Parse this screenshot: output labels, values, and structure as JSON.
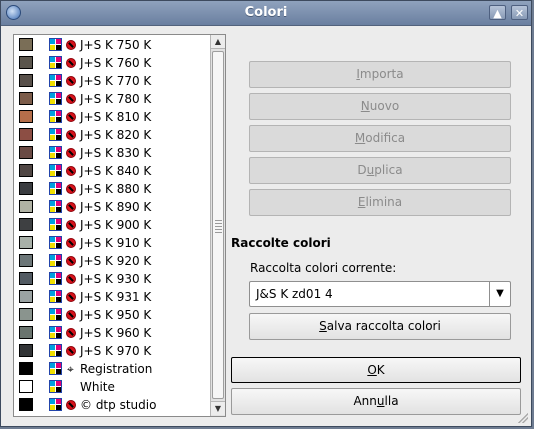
{
  "window": {
    "title": "Colori",
    "buttons": {
      "maximize_glyph": "▲",
      "close_glyph": "✕"
    }
  },
  "colors": [
    {
      "name": "J+S K 750 K",
      "swatch": "#7a6e57",
      "kind": "spot"
    },
    {
      "name": "J+S K 760 K",
      "swatch": "#5a554c",
      "kind": "spot"
    },
    {
      "name": "J+S K 770 K",
      "swatch": "#58504a",
      "kind": "spot"
    },
    {
      "name": "J+S K 780 K",
      "swatch": "#7c5c4a",
      "kind": "spot"
    },
    {
      "name": "J+S K 810 K",
      "swatch": "#b56e4a",
      "kind": "spot"
    },
    {
      "name": "J+S K 820 K",
      "swatch": "#8c4e44",
      "kind": "spot"
    },
    {
      "name": "J+S K 830 K",
      "swatch": "#6a4a44",
      "kind": "spot"
    },
    {
      "name": "J+S K 840 K",
      "swatch": "#504644",
      "kind": "spot"
    },
    {
      "name": "J+S K 880 K",
      "swatch": "#3a3c40",
      "kind": "spot"
    },
    {
      "name": "J+S K 890 K",
      "swatch": "#b0b2a4",
      "kind": "spot"
    },
    {
      "name": "J+S K 900 K",
      "swatch": "#3e4042",
      "kind": "spot"
    },
    {
      "name": "J+S K 910 K",
      "swatch": "#a8b0a8",
      "kind": "spot"
    },
    {
      "name": "J+S K 920 K",
      "swatch": "#6c7678",
      "kind": "spot"
    },
    {
      "name": "J+S K 930 K",
      "swatch": "#525a62",
      "kind": "spot"
    },
    {
      "name": "J+S K 931 K",
      "swatch": "#9aa2a2",
      "kind": "spot"
    },
    {
      "name": "J+S K 950 K",
      "swatch": "#8a948e",
      "kind": "spot"
    },
    {
      "name": "J+S K 960 K",
      "swatch": "#6a746e",
      "kind": "spot"
    },
    {
      "name": "J+S K 970 K",
      "swatch": "#323436",
      "kind": "spot"
    },
    {
      "name": "Registration",
      "swatch": "#000000",
      "kind": "registration"
    },
    {
      "name": "White",
      "swatch": "#ffffff",
      "kind": "process"
    },
    {
      "name": "© dtp studio",
      "swatch": "#000000",
      "kind": "spot"
    }
  ],
  "actions": {
    "import": {
      "label": "Importa",
      "mnemonic_index": 0
    },
    "new": {
      "label": "Nuovo",
      "mnemonic_index": 0
    },
    "edit": {
      "label": "Modifica",
      "mnemonic_index": 0
    },
    "duplicate": {
      "label": "Duplica",
      "mnemonic_index": 1
    },
    "delete": {
      "label": "Elimina",
      "mnemonic_index": 0
    }
  },
  "collections": {
    "section_title": "Raccolte colori",
    "current_label": "Raccolta colori corrente:",
    "current_value": "J&S K zd01 4",
    "save_label": "Salva raccolta colori"
  },
  "dialog": {
    "ok_label": "OK",
    "cancel_label": "Annulla"
  }
}
